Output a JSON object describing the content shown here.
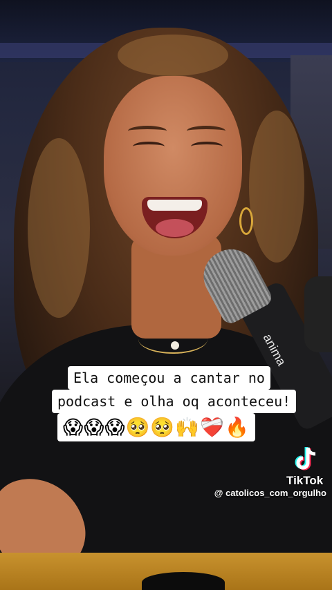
{
  "caption": {
    "line1": "Ela começou a cantar no",
    "line2": "podcast e olha oq aconteceu!",
    "emojis": "😱😱😱🥺🥺🙌❤️‍🩹🔥"
  },
  "microphone": {
    "brand": "anima"
  },
  "watermark": {
    "platform": "TikTok",
    "handle": "@ catolicos_com_orgulho"
  }
}
